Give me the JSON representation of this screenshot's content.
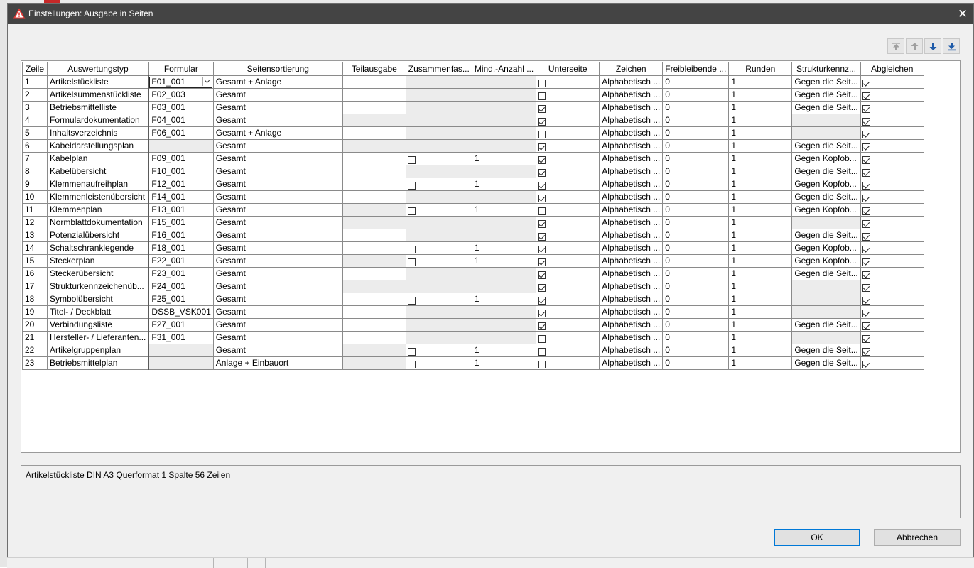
{
  "dialog": {
    "title": "Einstellungen: Ausgabe in Seiten",
    "close_symbol": "✕",
    "icon": "warning-triangle-icon",
    "accent": "#0078d7"
  },
  "toolbar": {
    "buttons": [
      {
        "name": "move-top",
        "icon": "arrow-to-top-icon",
        "enabled": false
      },
      {
        "name": "move-up",
        "icon": "arrow-up-icon",
        "enabled": false
      },
      {
        "name": "move-down",
        "icon": "arrow-down-icon",
        "enabled": true
      },
      {
        "name": "move-bottom",
        "icon": "arrow-to-bottom-icon",
        "enabled": true
      }
    ]
  },
  "grid": {
    "columns": [
      "Zeile",
      "Auswertungstyp",
      "Formular",
      "Seitensortierung",
      "Teilausgabe",
      "Zusammenfas...",
      "Mind.-Anzahl ...",
      "Unterseite",
      "Zeichen",
      "Freibleibende ...",
      "Runden",
      "Strukturkennz...",
      "Abgleichen"
    ],
    "rows": [
      {
        "zeile": "1",
        "typ": "Artikelstückliste",
        "formular": "F01_001",
        "sort": "Gesamt + Anlage",
        "teil": false,
        "zus": null,
        "mind": "",
        "unter": false,
        "zeichen": "Alphabetisch ...",
        "frei": "0",
        "runden": "1",
        "struktur": "Gegen die Seit...",
        "abgl": true
      },
      {
        "zeile": "2",
        "typ": "Artikelsummenstückliste",
        "formular": "F02_003",
        "sort": "Gesamt",
        "teil": false,
        "zus": null,
        "mind": "",
        "unter": false,
        "zeichen": "Alphabetisch ...",
        "frei": "0",
        "runden": "1",
        "struktur": "Gegen die Seit...",
        "abgl": true
      },
      {
        "zeile": "3",
        "typ": "Betriebsmittelliste",
        "formular": "F03_001",
        "sort": "Gesamt",
        "teil": false,
        "zus": null,
        "mind": "",
        "unter": true,
        "zeichen": "Alphabetisch ...",
        "frei": "0",
        "runden": "1",
        "struktur": "Gegen die Seit...",
        "abgl": true
      },
      {
        "zeile": "4",
        "typ": "Formulardokumentation",
        "formular": "F04_001",
        "sort": "Gesamt",
        "teil": null,
        "zus": null,
        "mind": "",
        "unter": true,
        "zeichen": "Alphabetisch ...",
        "frei": "0",
        "runden": "1",
        "struktur": "",
        "abgl": true
      },
      {
        "zeile": "5",
        "typ": "Inhaltsverzeichnis",
        "formular": "F06_001",
        "sort": "Gesamt + Anlage",
        "teil": false,
        "zus": null,
        "mind": "",
        "unter": false,
        "zeichen": "Alphabetisch ...",
        "frei": "0",
        "runden": "1",
        "struktur": null,
        "abgl": true
      },
      {
        "zeile": "6",
        "typ": "Kabeldarstellungsplan",
        "formular": "",
        "sort": "Gesamt",
        "teil": null,
        "zus": null,
        "mind": "",
        "unter": true,
        "zeichen": "Alphabetisch ...",
        "frei": "0",
        "runden": "1",
        "struktur": "Gegen die Seit...",
        "abgl": true
      },
      {
        "zeile": "7",
        "typ": "Kabelplan",
        "formular": "F09_001",
        "sort": "Gesamt",
        "teil": false,
        "zus": false,
        "mind": "1",
        "unter": true,
        "zeichen": "Alphabetisch ...",
        "frei": "0",
        "runden": "1",
        "struktur": "Gegen Kopfob...",
        "abgl": true
      },
      {
        "zeile": "8",
        "typ": "Kabelübersicht",
        "formular": "F10_001",
        "sort": "Gesamt",
        "teil": false,
        "zus": null,
        "mind": "",
        "unter": true,
        "zeichen": "Alphabetisch ...",
        "frei": "0",
        "runden": "1",
        "struktur": "Gegen die Seit...",
        "abgl": true
      },
      {
        "zeile": "9",
        "typ": "Klemmenaufreihplan",
        "formular": "F12_001",
        "sort": "Gesamt",
        "teil": false,
        "zus": false,
        "mind": "1",
        "unter": true,
        "zeichen": "Alphabetisch ...",
        "frei": "0",
        "runden": "1",
        "struktur": "Gegen Kopfob...",
        "abgl": true
      },
      {
        "zeile": "10",
        "typ": "Klemmenleistenübersicht",
        "formular": "F14_001",
        "sort": "Gesamt",
        "teil": false,
        "zus": null,
        "mind": "",
        "unter": true,
        "zeichen": "Alphabetisch ...",
        "frei": "0",
        "runden": "1",
        "struktur": "Gegen die Seit...",
        "abgl": true
      },
      {
        "zeile": "11",
        "typ": "Klemmenplan",
        "formular": "F13_001",
        "sort": "Gesamt",
        "teil": null,
        "zus": false,
        "mind": "1",
        "unter": false,
        "zeichen": "Alphabetisch ...",
        "frei": "0",
        "runden": "1",
        "struktur": "Gegen Kopfob...",
        "abgl": true
      },
      {
        "zeile": "12",
        "typ": "Normblattdokumentation",
        "formular": "F15_001",
        "sort": "Gesamt",
        "teil": null,
        "zus": null,
        "mind": "",
        "unter": true,
        "zeichen": "Alphabetisch ...",
        "frei": "0",
        "runden": "1",
        "struktur": "",
        "abgl": true
      },
      {
        "zeile": "13",
        "typ": "Potenzialübersicht",
        "formular": "F16_001",
        "sort": "Gesamt",
        "teil": false,
        "zus": null,
        "mind": "",
        "unter": true,
        "zeichen": "Alphabetisch ...",
        "frei": "0",
        "runden": "1",
        "struktur": "Gegen die Seit...",
        "abgl": true
      },
      {
        "zeile": "14",
        "typ": "Schaltschranklegende",
        "formular": "F18_001",
        "sort": "Gesamt",
        "teil": false,
        "zus": false,
        "mind": "1",
        "unter": true,
        "zeichen": "Alphabetisch ...",
        "frei": "0",
        "runden": "1",
        "struktur": "Gegen Kopfob...",
        "abgl": true
      },
      {
        "zeile": "15",
        "typ": "Steckerplan",
        "formular": "F22_001",
        "sort": "Gesamt",
        "teil": null,
        "zus": false,
        "mind": "1",
        "unter": true,
        "zeichen": "Alphabetisch ...",
        "frei": "0",
        "runden": "1",
        "struktur": "Gegen Kopfob...",
        "abgl": true
      },
      {
        "zeile": "16",
        "typ": "Steckerübersicht",
        "formular": "F23_001",
        "sort": "Gesamt",
        "teil": false,
        "zus": null,
        "mind": "",
        "unter": true,
        "zeichen": "Alphabetisch ...",
        "frei": "0",
        "runden": "1",
        "struktur": "Gegen die Seit...",
        "abgl": true
      },
      {
        "zeile": "17",
        "typ": "Strukturkennzeichenüb...",
        "formular": "F24_001",
        "sort": "Gesamt",
        "teil": null,
        "zus": null,
        "mind": "",
        "unter": true,
        "zeichen": "Alphabetisch ...",
        "frei": "0",
        "runden": "1",
        "struktur": "",
        "abgl": true
      },
      {
        "zeile": "18",
        "typ": "Symbolübersicht",
        "formular": "F25_001",
        "sort": "Gesamt",
        "teil": false,
        "zus": false,
        "mind": "1",
        "unter": true,
        "zeichen": "Alphabetisch ...",
        "frei": "0",
        "runden": "1",
        "struktur": "",
        "abgl": true
      },
      {
        "zeile": "19",
        "typ": "Titel- / Deckblatt",
        "formular": "DSSB_VSK001",
        "sort": "Gesamt",
        "teil": false,
        "zus": null,
        "mind": "",
        "unter": true,
        "zeichen": "Alphabetisch ...",
        "frei": "0",
        "runden": "1",
        "struktur": "",
        "abgl": true
      },
      {
        "zeile": "20",
        "typ": "Verbindungsliste",
        "formular": "F27_001",
        "sort": "Gesamt",
        "teil": false,
        "zus": null,
        "mind": "",
        "unter": true,
        "zeichen": "Alphabetisch ...",
        "frei": "0",
        "runden": "1",
        "struktur": "Gegen die Seit...",
        "abgl": true
      },
      {
        "zeile": "21",
        "typ": "Hersteller- / Lieferanten...",
        "formular": "F31_001",
        "sort": "Gesamt",
        "teil": false,
        "zus": null,
        "mind": "",
        "unter": false,
        "zeichen": "Alphabetisch ...",
        "frei": "0",
        "runden": "1",
        "struktur": "",
        "abgl": true
      },
      {
        "zeile": "22",
        "typ": "Artikelgruppenplan",
        "formular": "",
        "sort": "Gesamt",
        "teil": null,
        "zus": false,
        "mind": "1",
        "unter": false,
        "zeichen": "Alphabetisch ...",
        "frei": "0",
        "runden": "1",
        "struktur": "Gegen die Seit...",
        "abgl": true
      },
      {
        "zeile": "23",
        "typ": "Betriebsmittelplan",
        "formular": "",
        "sort": "Anlage + Einbauort",
        "teil": null,
        "zus": false,
        "mind": "1",
        "unter": false,
        "zeichen": "Alphabetisch ...",
        "frei": "0",
        "runden": "1",
        "struktur": "Gegen die Seit...",
        "abgl": true
      }
    ]
  },
  "description": "Artikelstückliste DIN A3 Querformat 1 Spalte 56 Zeilen",
  "buttons": {
    "ok": "OK",
    "cancel": "Abbrechen"
  }
}
